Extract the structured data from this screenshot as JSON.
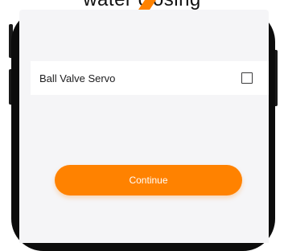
{
  "header": {
    "title": "water closing"
  },
  "options": [
    {
      "label": "Ball Valve Servo",
      "checked": false
    }
  ],
  "actions": {
    "continue_label": "Continue"
  },
  "colors": {
    "accent": "#ff8200",
    "screen_background": "#f5f5f7"
  }
}
